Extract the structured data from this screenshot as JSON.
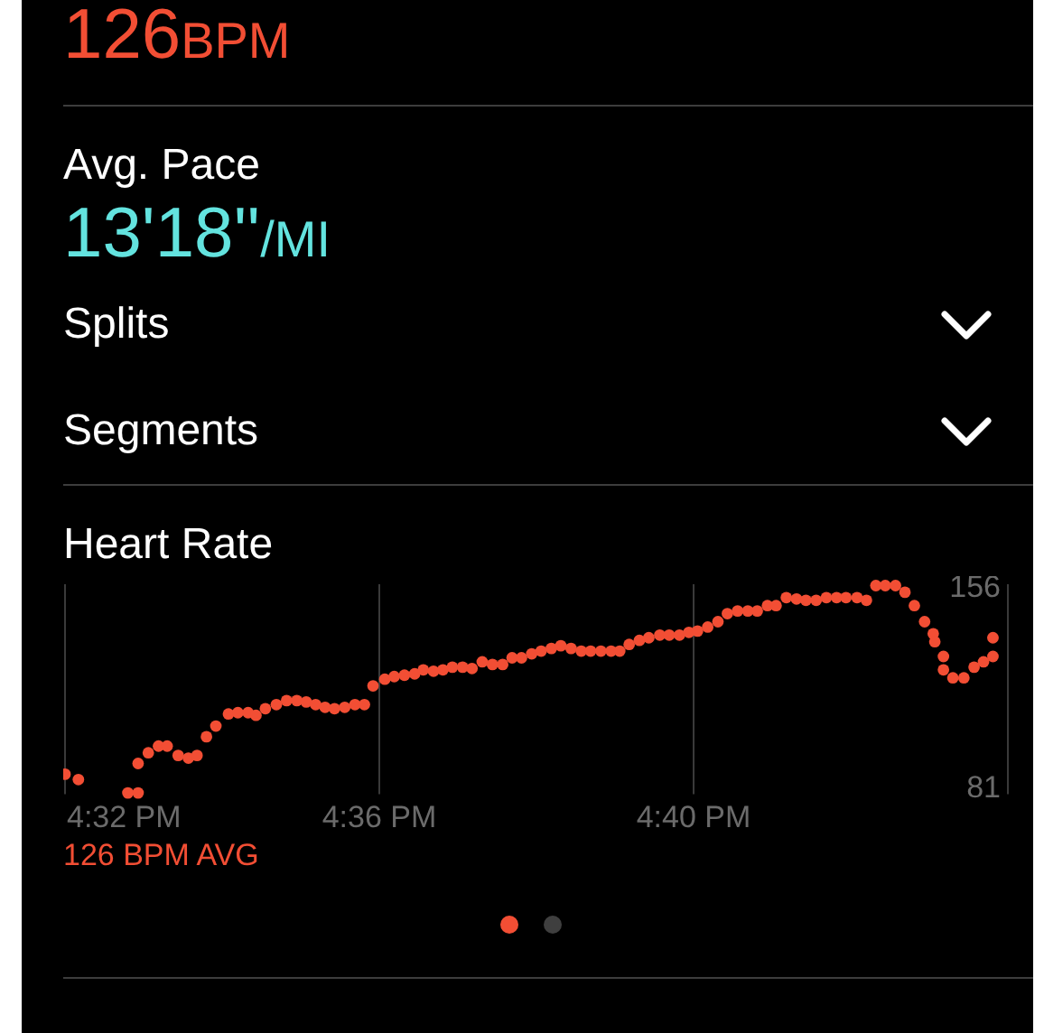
{
  "heart_rate_summary": {
    "value": "126",
    "unit": "BPM"
  },
  "avg_pace": {
    "label": "Avg. Pace",
    "value": "13'18''",
    "unit": "/MI"
  },
  "sections": [
    {
      "label": "Splits",
      "expanded": false
    },
    {
      "label": "Segments",
      "expanded": false
    }
  ],
  "heart_rate_chart": {
    "title": "Heart Rate",
    "average": "126 BPM AVG",
    "chart_data": {
      "type": "scatter",
      "xlim": [
        992,
        1004
      ],
      "ylim": [
        78.5,
        157
      ],
      "xticks": [
        {
          "value": 992,
          "label": "4:32 PM"
        },
        {
          "value": 996,
          "label": "4:36 PM"
        },
        {
          "value": 1000,
          "label": "4:40 PM"
        }
      ],
      "yticks": [
        81,
        156
      ],
      "series": [
        {
          "color": "#f24e34",
          "x": [
            992,
            992.17,
            992.8,
            992.93,
            992.93,
            993.06,
            993.19,
            993.3,
            993.44,
            993.57,
            993.68,
            993.8,
            993.92,
            994.08,
            994.2,
            994.33,
            994.43,
            994.55,
            994.69,
            994.82,
            994.95,
            995.07,
            995.19,
            995.31,
            995.43,
            995.56,
            995.69,
            995.81,
            995.92,
            996.07,
            996.19,
            996.32,
            996.45,
            996.56,
            996.69,
            996.81,
            996.93,
            997.06,
            997.18,
            997.31,
            997.44,
            997.57,
            997.69,
            997.81,
            997.94,
            998.06,
            998.19,
            998.31,
            998.44,
            998.57,
            998.69,
            998.82,
            998.95,
            999.06,
            999.18,
            999.31,
            999.43,
            999.57,
            999.69,
            999.82,
            999.94,
            1000.05,
            1000.18,
            1000.31,
            1000.43,
            1000.56,
            1000.69,
            1000.81,
            1000.94,
            1001.05,
            1001.18,
            1001.31,
            1001.43,
            1001.56,
            1001.69,
            1001.82,
            1001.94,
            1002.08,
            1002.2,
            1002.32,
            1002.44,
            1002.57,
            1002.69,
            1002.81,
            1002.94,
            1003.05,
            1003.07,
            1003.18,
            1003.18,
            1003.3,
            1003.44,
            1003.57,
            1003.69,
            1003.81,
            1003.81
          ],
          "values": [
            86,
            84,
            79,
            79,
            90,
            94,
            96.5,
            96.5,
            93,
            92,
            93,
            100,
            104,
            108.5,
            109,
            109,
            108,
            110.5,
            112,
            113.5,
            113.5,
            113,
            112,
            111,
            110.5,
            111,
            112,
            112,
            119,
            121.5,
            122.5,
            123,
            123.5,
            125,
            124.5,
            125,
            126,
            126,
            125.5,
            128,
            127,
            127,
            129.5,
            129.5,
            131,
            132,
            133,
            134,
            133,
            132,
            132,
            132,
            132,
            132,
            134.5,
            136,
            137,
            138,
            138,
            138,
            139,
            139.5,
            141,
            143,
            146,
            147,
            147,
            147,
            149,
            149,
            152,
            151.5,
            151,
            151,
            152,
            152,
            152,
            152,
            151,
            156.5,
            156.5,
            156.5,
            154,
            149,
            143,
            138.5,
            135.5,
            130,
            125,
            122,
            122,
            126,
            128,
            130,
            137
          ]
        }
      ]
    }
  },
  "page_indicator": [
    {
      "selected": true
    },
    {
      "selected": false
    }
  ]
}
